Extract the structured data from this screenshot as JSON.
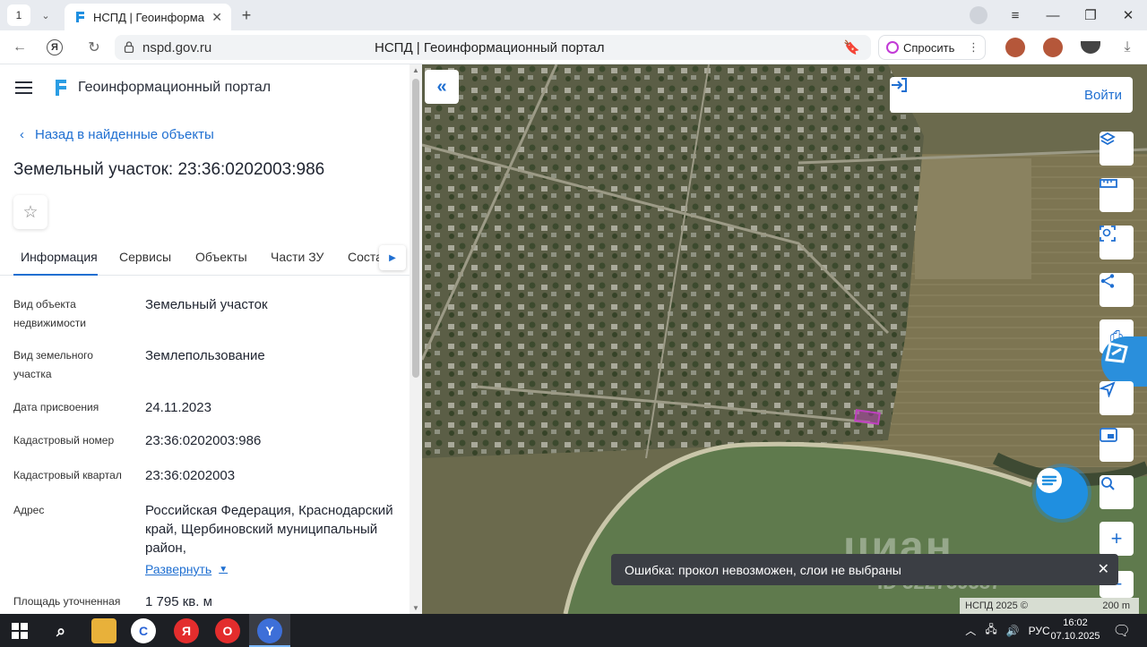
{
  "browser": {
    "tab_count": "1",
    "tab_title": "НСПД | Геоинформацио",
    "url": "nspd.gov.ru",
    "page_title": "НСПД | Геоинформационный портал",
    "ask_label": "Спросить"
  },
  "panel": {
    "portal_name": "Геоинформационный портал",
    "back_label": "Назад в найденные объекты",
    "title": "Земельный участок: 23:36:0202003:986",
    "tabs": [
      "Информация",
      "Сервисы",
      "Объекты",
      "Части ЗУ",
      "Соста"
    ],
    "active_tab": "Информация",
    "rows": [
      {
        "key": "Вид объекта недвижимости",
        "value": "Земельный участок"
      },
      {
        "key": "Вид земельного участка",
        "value": "Землепользование"
      },
      {
        "key": "Дата присвоения",
        "value": "24.11.2023"
      },
      {
        "key": "Кадастровый номер",
        "value": "23:36:0202003:986"
      },
      {
        "key": "Кадастровый квартал",
        "value": "23:36:0202003"
      },
      {
        "key": "Адрес",
        "value": "Российская Федерация, Краснодарский край, Щербиновский муниципальный район,"
      },
      {
        "key": "Площадь уточненная",
        "value": "1 795 кв. м"
      }
    ],
    "expand_label": "Развернуть"
  },
  "map": {
    "login_label": "Войти",
    "error_toast": "Ошибка: прокол невозможен, слои не выбраны",
    "copyright": "НСПД 2025 ©",
    "scale": "200 m",
    "watermark": "циан",
    "watermark_id": "ID 322739587",
    "tools": [
      "layers-icon",
      "ruler-icon",
      "select-area-icon",
      "share-icon",
      "print-icon",
      "geolocation-icon",
      "minimap-icon",
      "search-location-icon",
      "zoom-in-icon",
      "zoom-out-icon"
    ]
  },
  "taskbar": {
    "lang": "РУС",
    "time": "16:02",
    "date": "07.10.2025"
  },
  "colors": {
    "accent": "#1f6fd1",
    "water": "#5f7a4d",
    "toast_bg": "#3b3e44",
    "parcel": "#c040c0"
  }
}
